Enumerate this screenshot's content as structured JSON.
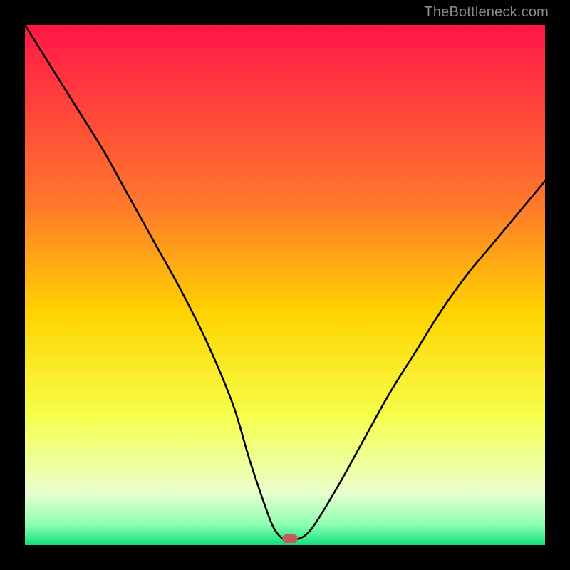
{
  "watermark": "TheBottleneck.com",
  "chart_data": {
    "type": "line",
    "title": "",
    "xlabel": "",
    "ylabel": "",
    "xlim": [
      0,
      100
    ],
    "ylim": [
      0,
      100
    ],
    "grid": false,
    "legend": false,
    "gradient_stops": [
      {
        "pct": 0,
        "color": "#ff1648"
      },
      {
        "pct": 35,
        "color": "#ff7a2b"
      },
      {
        "pct": 55,
        "color": "#ffd200"
      },
      {
        "pct": 75,
        "color": "#f6ff4a"
      },
      {
        "pct": 90,
        "color": "#e9ffce"
      },
      {
        "pct": 96,
        "color": "#8effb0"
      },
      {
        "pct": 100,
        "color": "#11e07b"
      }
    ],
    "series": [
      {
        "name": "bottleneck-curve",
        "x": [
          0,
          5,
          10,
          15,
          20,
          25,
          30,
          35,
          40,
          43,
          46,
          48,
          50,
          52,
          55,
          60,
          65,
          70,
          75,
          80,
          85,
          90,
          95,
          100
        ],
        "y": [
          100,
          92,
          84,
          76,
          67,
          58,
          49,
          39,
          27,
          17,
          8,
          3,
          1,
          1,
          3,
          11,
          20,
          29,
          37,
          45,
          52,
          58,
          64,
          70
        ]
      }
    ],
    "marker": {
      "x": 51,
      "y": 1.2,
      "color": "#c45a5a"
    }
  }
}
